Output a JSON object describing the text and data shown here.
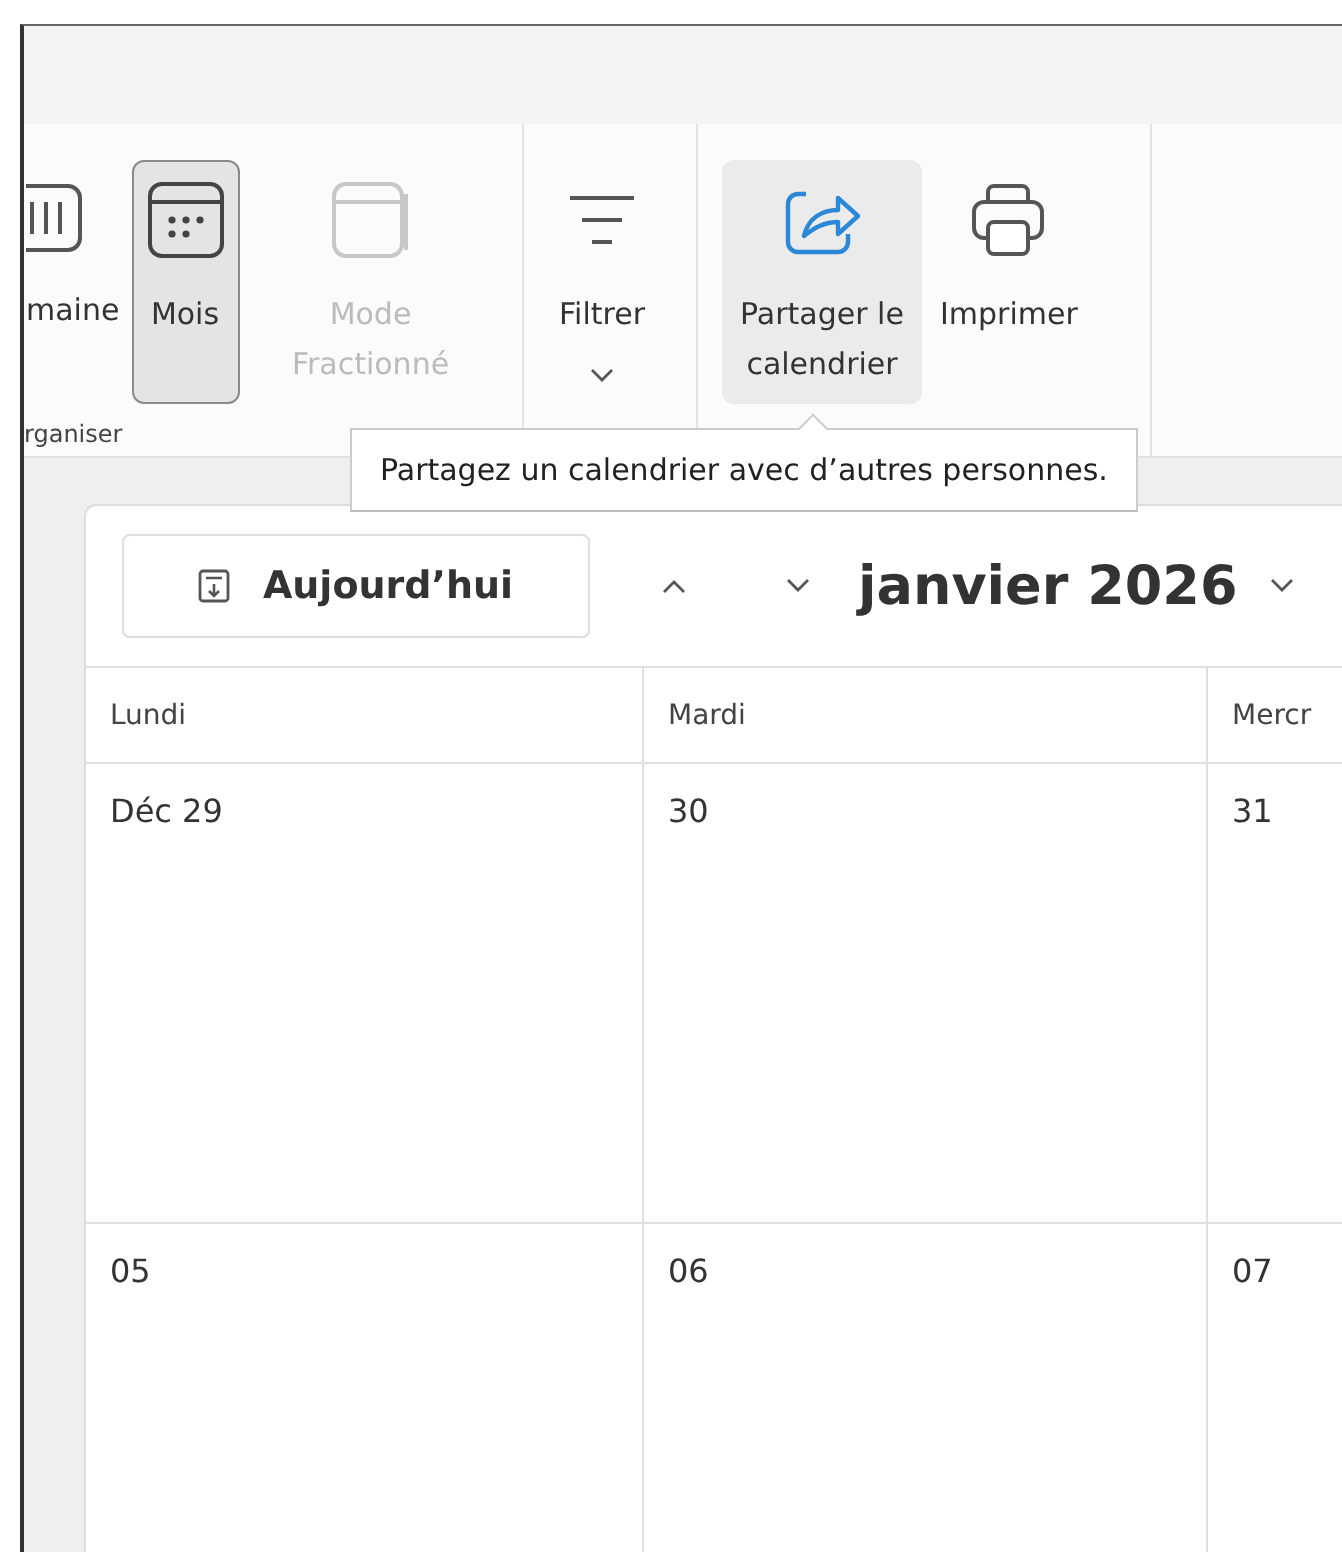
{
  "ribbon": {
    "groups": [
      {
        "label": "rganiser",
        "buttons": [
          {
            "label": "maine",
            "selected": false,
            "hovered": false,
            "disabled": false,
            "dropdown": false
          },
          {
            "label": "Mois",
            "selected": true,
            "hovered": false,
            "disabled": false,
            "dropdown": false
          },
          {
            "label": "Mode Fractionné",
            "selected": false,
            "hovered": false,
            "disabled": true,
            "dropdown": false
          }
        ]
      },
      {
        "buttons": [
          {
            "label": "Filtrer",
            "selected": false,
            "hovered": false,
            "disabled": false,
            "dropdown": true
          }
        ]
      },
      {
        "buttons": [
          {
            "label": "Partager le calendrier",
            "selected": false,
            "hovered": true,
            "disabled": false,
            "dropdown": false
          },
          {
            "label": "Imprimer",
            "selected": false,
            "hovered": false,
            "disabled": false,
            "dropdown": false
          }
        ]
      }
    ]
  },
  "tooltip": "Partagez un calendrier avec d’autres personnes.",
  "toolbar": {
    "today": "Aujourd’hui",
    "month": "janvier 2026"
  },
  "calendar": {
    "weekdays": [
      "Lundi",
      "Mardi",
      "Mercr"
    ],
    "weeks": [
      [
        "Déc 29",
        "30",
        "31"
      ],
      [
        "05",
        "06",
        "07"
      ]
    ]
  }
}
